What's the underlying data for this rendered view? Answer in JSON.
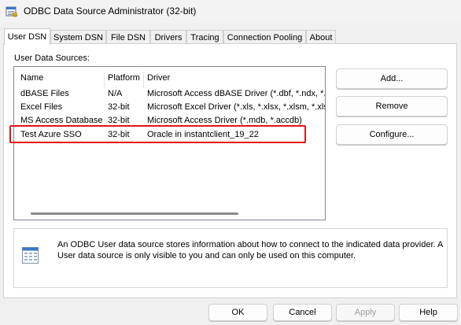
{
  "window": {
    "title": "ODBC Data Source Administrator (32-bit)"
  },
  "tabs": [
    {
      "label": "User DSN",
      "active": true
    },
    {
      "label": "System DSN",
      "active": false
    },
    {
      "label": "File DSN",
      "active": false
    },
    {
      "label": "Drivers",
      "active": false
    },
    {
      "label": "Tracing",
      "active": false
    },
    {
      "label": "Connection Pooling",
      "active": false
    },
    {
      "label": "About",
      "active": false
    }
  ],
  "user_dsn": {
    "section_label": "User Data Sources:",
    "columns": {
      "name": "Name",
      "platform": "Platform",
      "driver": "Driver"
    },
    "rows": [
      {
        "name": "dBASE Files",
        "platform": "N/A",
        "driver": "Microsoft Access dBASE Driver (*.dbf, *.ndx, *.m"
      },
      {
        "name": "Excel Files",
        "platform": "32-bit",
        "driver": "Microsoft Excel Driver (*.xls, *.xlsx, *.xlsm, *.xlsb)"
      },
      {
        "name": "MS Access Database",
        "platform": "32-bit",
        "driver": "Microsoft Access Driver (*.mdb, *.accdb)"
      },
      {
        "name": "Test Azure SSO",
        "platform": "32-bit",
        "driver": "Oracle in instantclient_19_22"
      }
    ],
    "highlight_color": "#e0161b",
    "buttons": {
      "add": "Add...",
      "remove": "Remove",
      "configure": "Configure..."
    },
    "info_text": "An ODBC User data source stores information about how to connect to the indicated data provider.   A User data source is only visible to you and can only be used on this computer."
  },
  "footer": {
    "ok": "OK",
    "cancel": "Cancel",
    "apply": "Apply",
    "help": "Help"
  }
}
